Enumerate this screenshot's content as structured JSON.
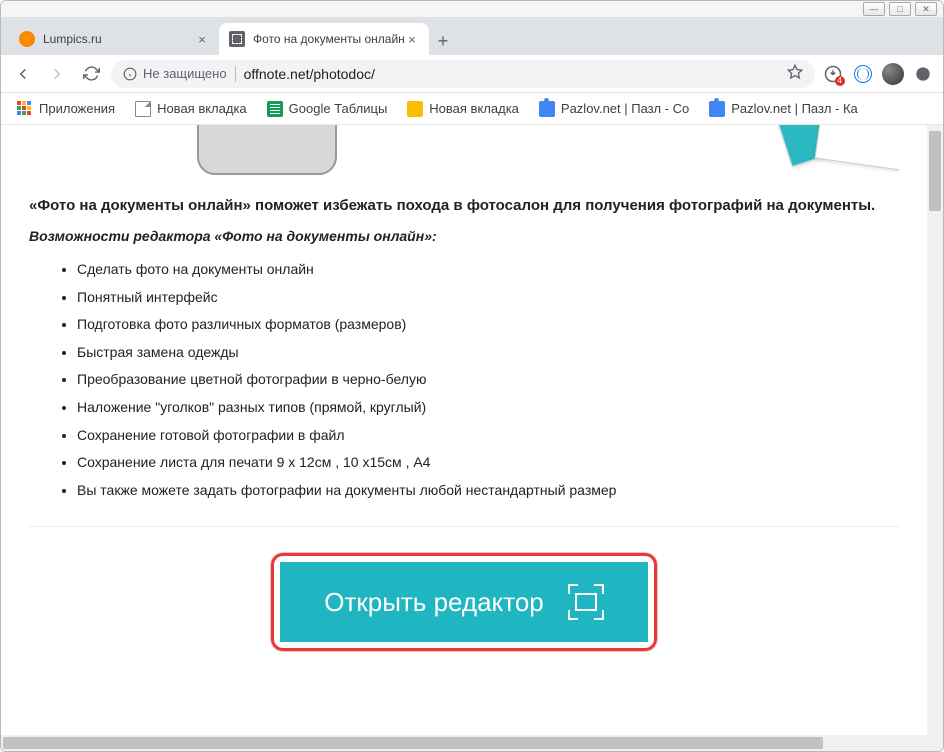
{
  "window_controls": {
    "min": "—",
    "max": "□",
    "close": "✕"
  },
  "tabs": [
    {
      "title": "Lumpics.ru",
      "active": false
    },
    {
      "title": "Фото на документы онлайн",
      "active": true
    }
  ],
  "address_bar": {
    "security_label": "Не защищено",
    "url": "offnote.net/photodoc/",
    "extension_badge": "4"
  },
  "bookmarks": [
    {
      "label": "Приложения",
      "icon": "apps"
    },
    {
      "label": "Новая вкладка",
      "icon": "page"
    },
    {
      "label": "Google Таблицы",
      "icon": "sheets"
    },
    {
      "label": "Новая вкладка",
      "icon": "yellow"
    },
    {
      "label": "Pazlov.net | Пазл - Со",
      "icon": "puzzle"
    },
    {
      "label": "Pazlov.net | Пазл - Ка",
      "icon": "puzzle"
    }
  ],
  "page": {
    "heading": "«Фото на документы онлайн» поможет избежать похода в фотосалон для получения фотографий на документы.",
    "subheading": "Возможности редактора «Фото на документы онлайн»:",
    "features": [
      "Сделать фото на документы онлайн",
      "Понятный интерфейс",
      "Подготовка фото различных форматов (размеров)",
      "Быстрая замена одежды",
      "Преобразование цветной фотографии в черно-белую",
      "Наложение \"уголков\" разных типов (прямой, круглый)",
      "Сохранение готовой фотографии в файл",
      "Сохранение листа для печати 9 x 12см , 10 x15см , A4",
      "Вы также можете задать фотографии на документы любой нестандартный размер"
    ],
    "cta_label": "Открыть редактор"
  }
}
